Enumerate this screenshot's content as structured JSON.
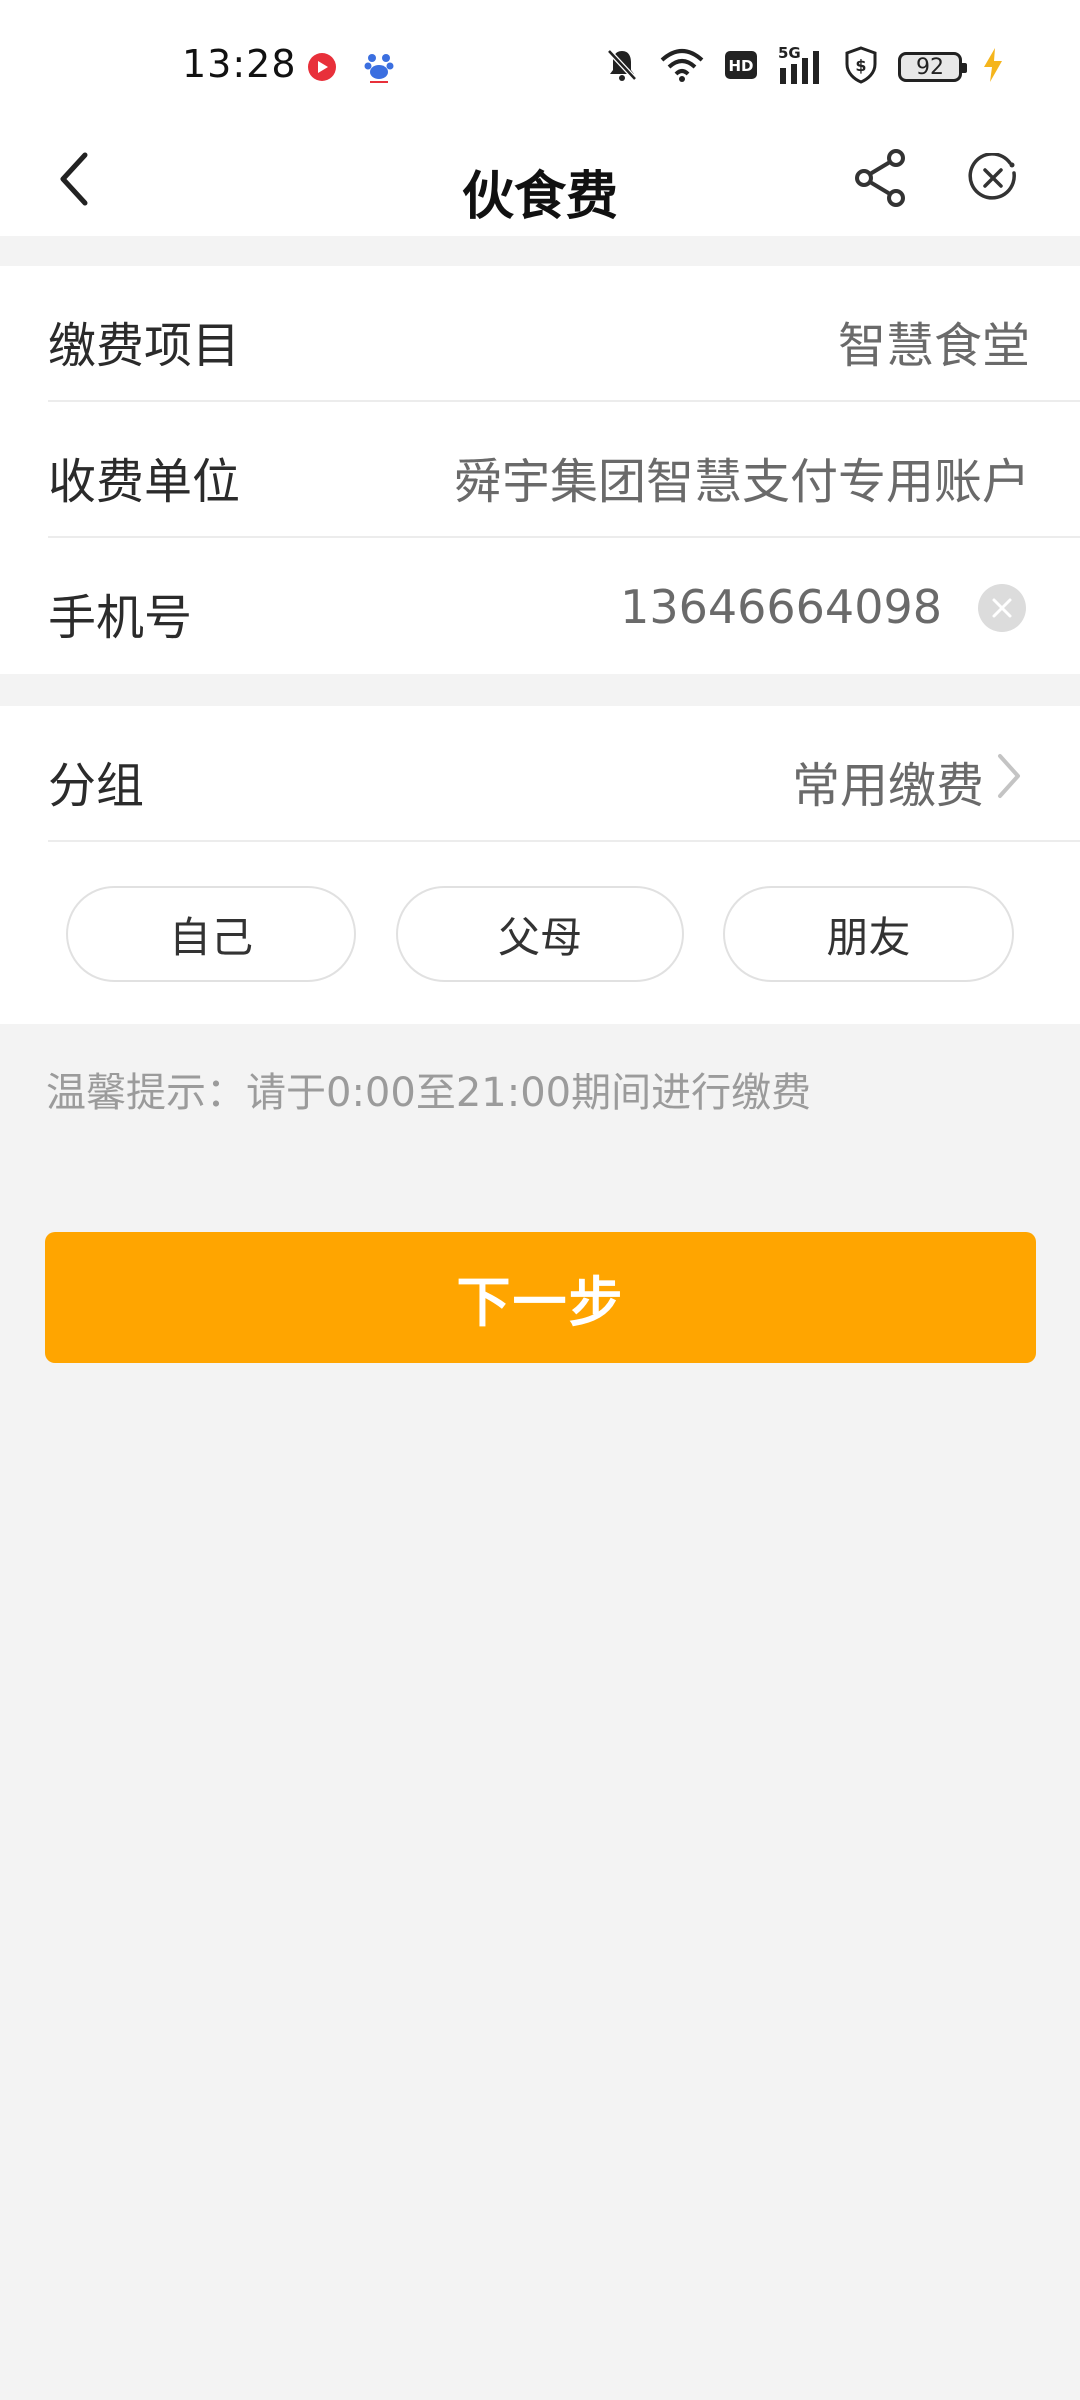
{
  "status_bar": {
    "time": "13:28",
    "battery_level": "92",
    "network": "5G",
    "hd_badge": "HD",
    "icons": [
      "video-app-icon",
      "baidu-icon",
      "mute-bell-icon",
      "wifi-icon",
      "hd-icon",
      "signal-icon",
      "shield-icon",
      "battery-icon",
      "charging-icon"
    ]
  },
  "header": {
    "title": "伙食费",
    "icons": [
      "back-arrow-icon",
      "share-icon",
      "close-circle-icon"
    ]
  },
  "form": {
    "payment_item": {
      "label": "缴费项目",
      "value": "智慧食堂"
    },
    "payee": {
      "label": "收费单位",
      "value": "舜宇集团智慧支付专用账户"
    },
    "phone": {
      "label": "手机号",
      "value": "13646664098"
    }
  },
  "group": {
    "label": "分组",
    "value": "常用缴费",
    "chips": [
      {
        "label": "自己"
      },
      {
        "label": "父母"
      },
      {
        "label": "朋友"
      }
    ]
  },
  "tip": "温馨提示：请于0:00至21:00期间进行缴费",
  "next_button": {
    "label": "下一步"
  },
  "colors": {
    "accent": "#FFA500",
    "background": "#F3F3F3",
    "card": "#FFFFFF"
  }
}
